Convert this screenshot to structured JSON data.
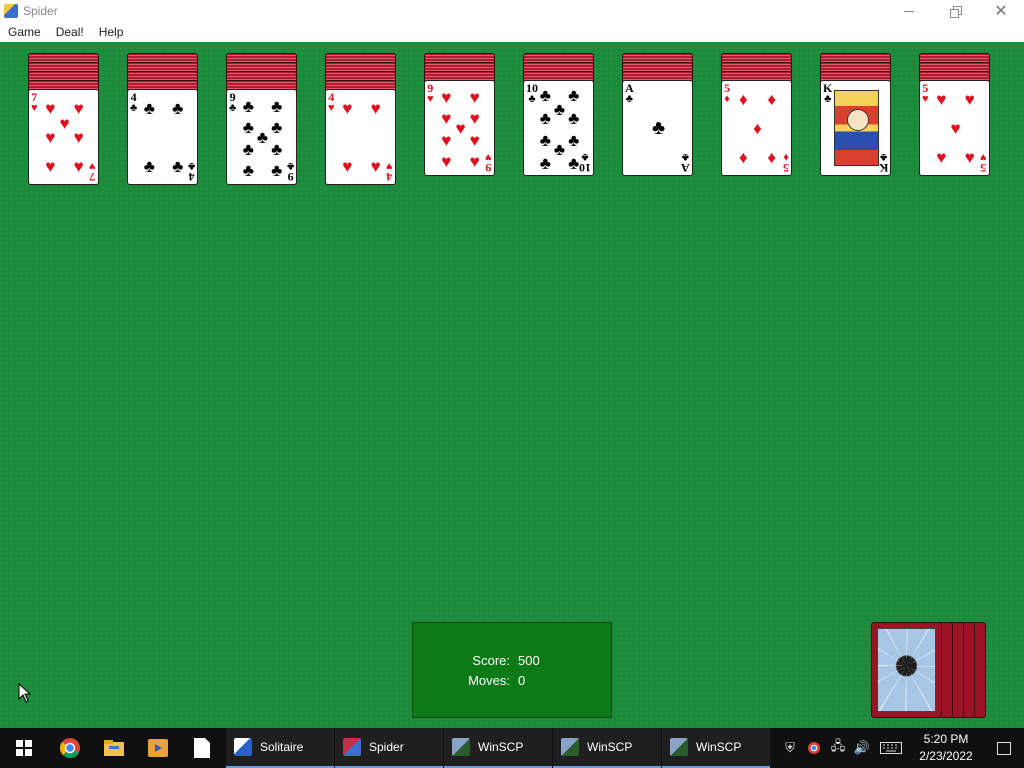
{
  "window": {
    "title": "Spider"
  },
  "menu": {
    "items": [
      "Game",
      "Deal!",
      "Help"
    ]
  },
  "columns": [
    {
      "face_down": 4,
      "rank": "7",
      "suit": "♥",
      "color": "red",
      "layout": "7"
    },
    {
      "face_down": 4,
      "rank": "4",
      "suit": "♣",
      "color": "black",
      "layout": "4"
    },
    {
      "face_down": 4,
      "rank": "9",
      "suit": "♣",
      "color": "black",
      "layout": "9"
    },
    {
      "face_down": 4,
      "rank": "4",
      "suit": "♥",
      "color": "red",
      "layout": "4"
    },
    {
      "face_down": 3,
      "rank": "9",
      "suit": "♥",
      "color": "red",
      "layout": "9"
    },
    {
      "face_down": 3,
      "rank": "10",
      "suit": "♣",
      "color": "black",
      "layout": "10"
    },
    {
      "face_down": 3,
      "rank": "A",
      "suit": "♣",
      "color": "black",
      "layout": "A"
    },
    {
      "face_down": 3,
      "rank": "5",
      "suit": "♦",
      "color": "red",
      "layout": "5"
    },
    {
      "face_down": 3,
      "rank": "K",
      "suit": "♣",
      "color": "black",
      "layout": "K"
    },
    {
      "face_down": 3,
      "rank": "5",
      "suit": "♥",
      "color": "red",
      "layout": "5"
    }
  ],
  "score": {
    "score_label": "Score:",
    "score_value": "500",
    "moves_label": "Moves:",
    "moves_value": "0"
  },
  "stock": {
    "piles": 5
  },
  "taskbar": {
    "pinned": [
      "chrome-icon",
      "file-explorer-icon",
      "media-player-icon",
      "file-icon"
    ],
    "tasks": [
      {
        "label": "Solitaire",
        "icon": "solitaire-icon"
      },
      {
        "label": "Spider",
        "icon": "spider-icon"
      },
      {
        "label": "WinSCP",
        "icon": "winscp-icon"
      },
      {
        "label": "WinSCP",
        "icon": "winscp-icon"
      },
      {
        "label": "WinSCP",
        "icon": "winscp-icon"
      }
    ],
    "time": "5:20 PM",
    "date": "2/23/2022"
  },
  "colors": {
    "felt": "#1b8b3b",
    "score_box": "#0c7a16",
    "card_back": "#a8182a",
    "red_suit": "#e0101e"
  }
}
